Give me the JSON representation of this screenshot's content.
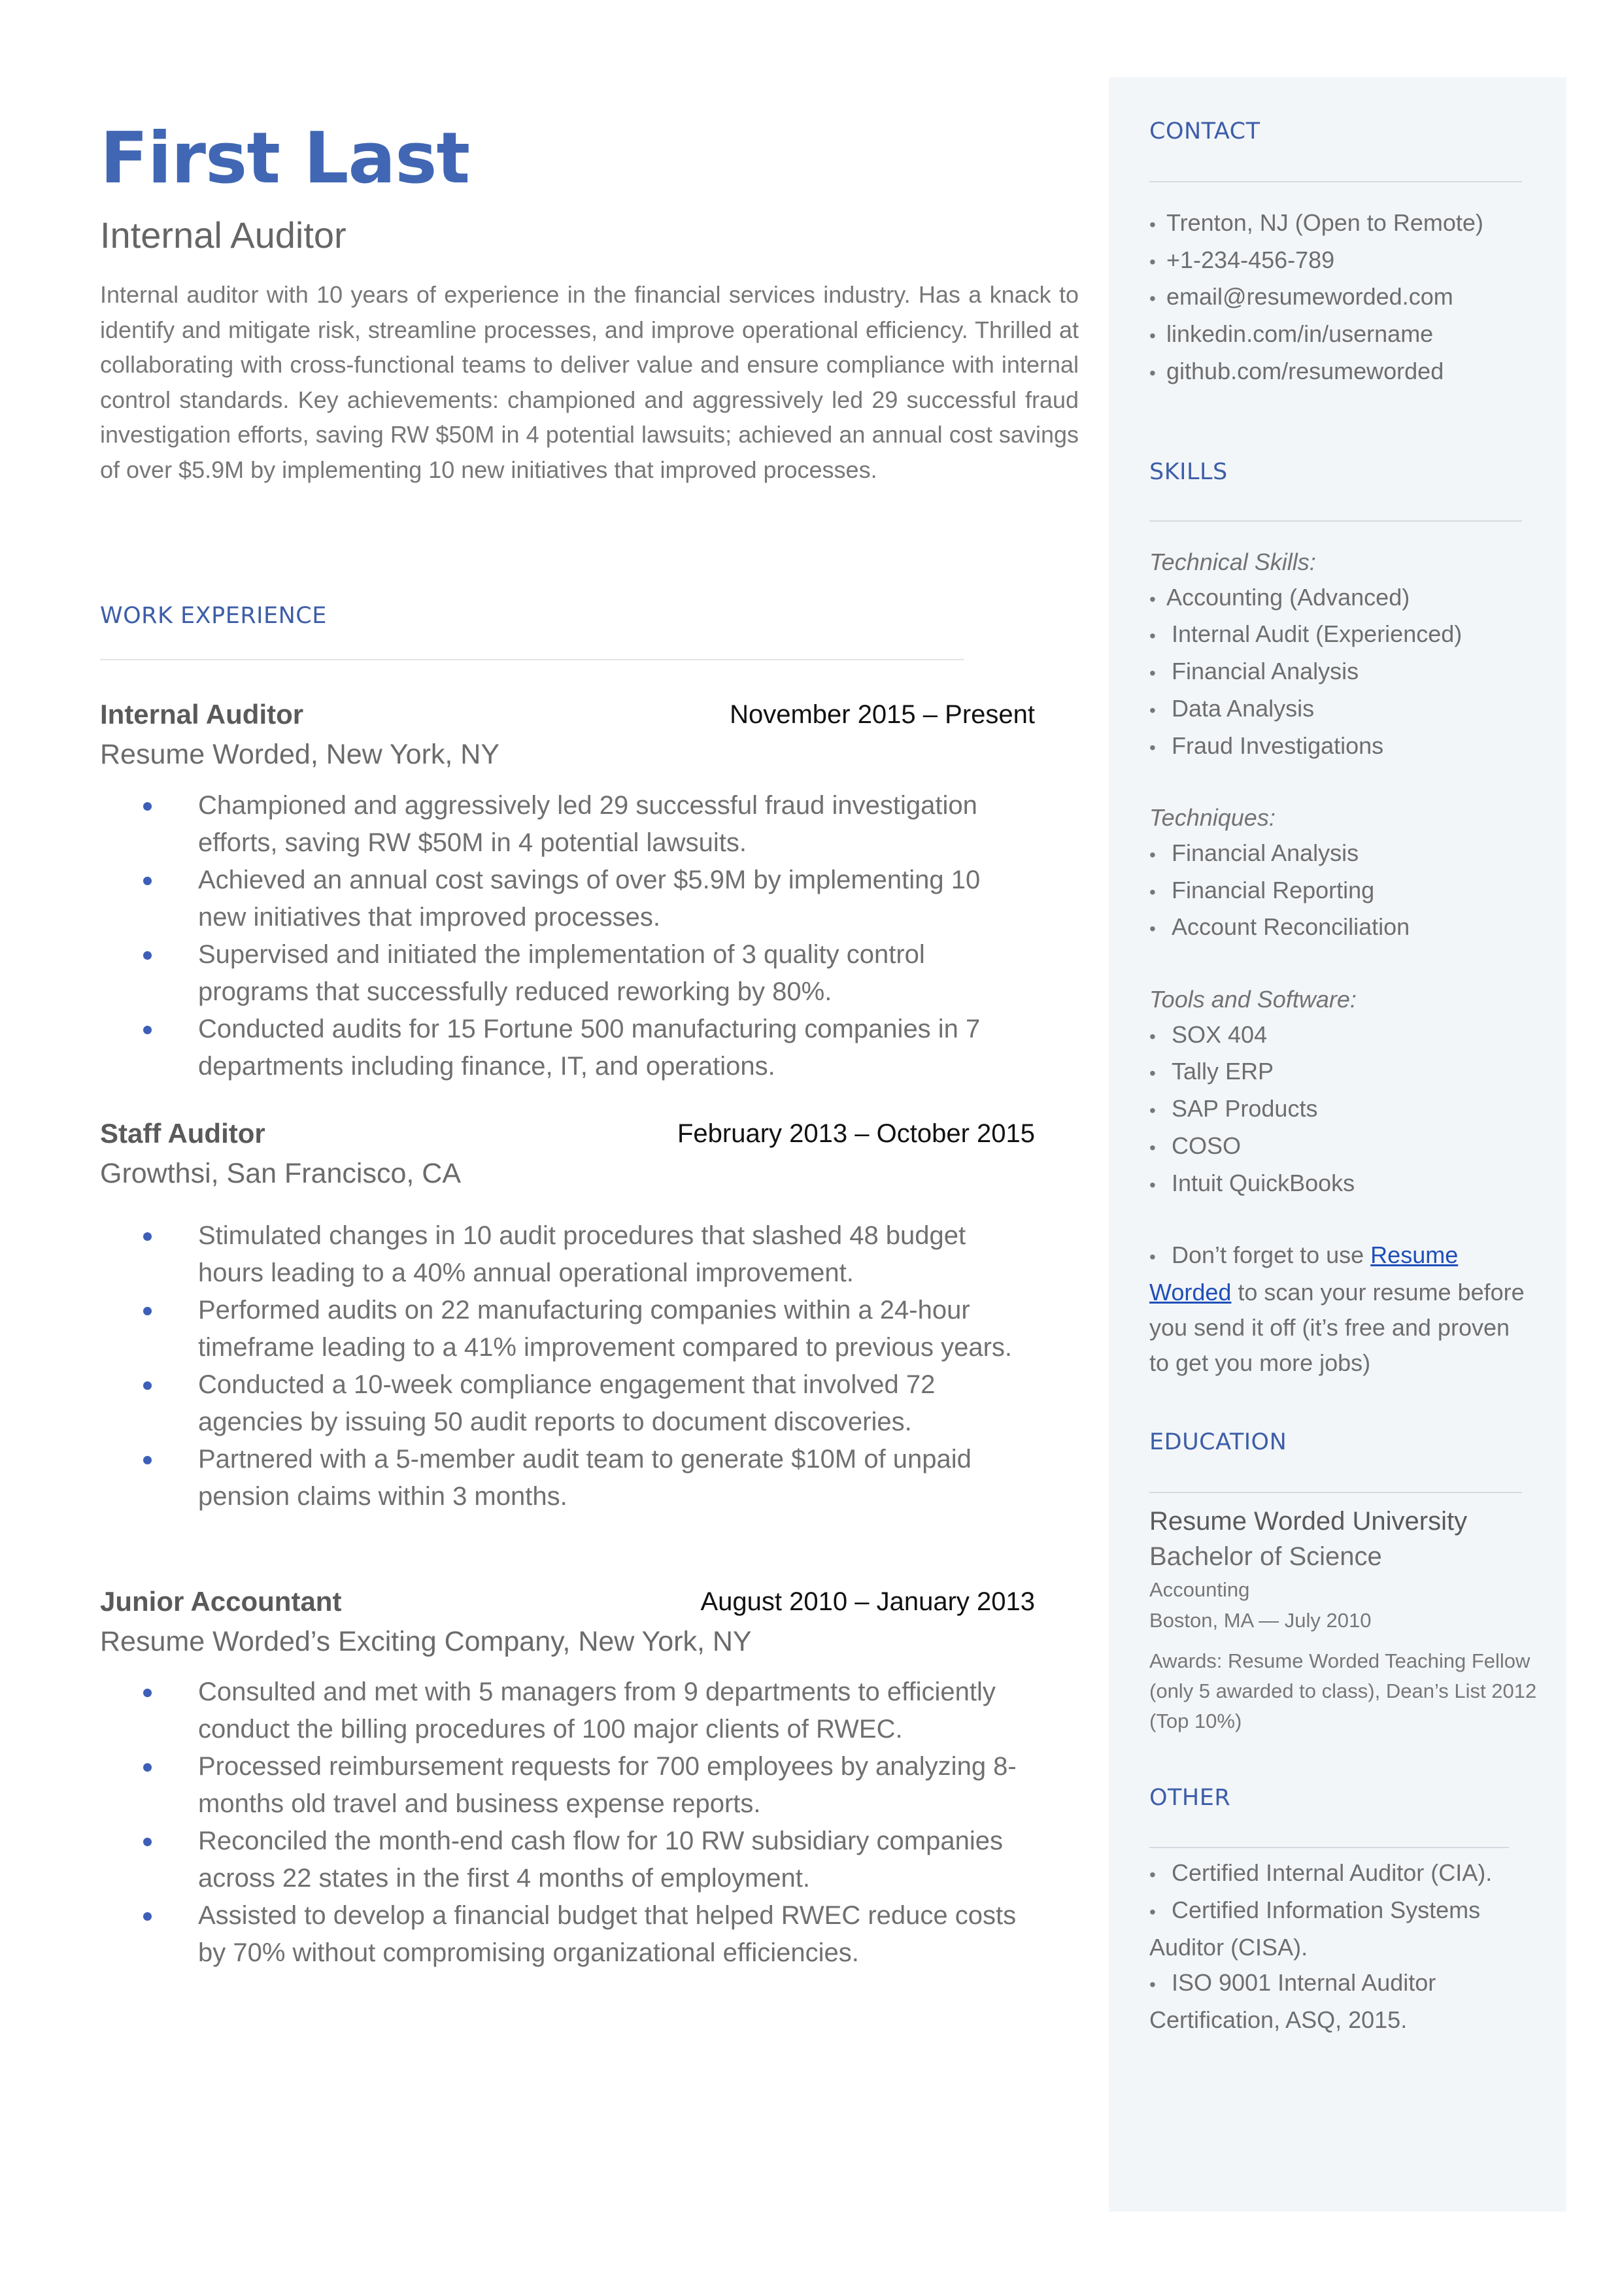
{
  "header": {
    "name": "First Last",
    "role": "Internal Auditor",
    "summary": "Internal auditor with 10 years of experience in the financial services industry. Has a knack to identify and mitigate risk, streamline processes, and improve operational efficiency. Thrilled at collaborating with cross-functional teams to deliver value and ensure compliance with internal control standards. Key achievements: championed and aggressively led 29 successful fraud investigation efforts, saving RW $50M in 4 potential lawsuits; achieved an annual cost savings of over $5.9M by implementing 10 new initiatives that improved processes."
  },
  "colors": {
    "accent": "#4167b4",
    "heading": "#3d5ea8",
    "sidebar_bg": "#f3f6f9",
    "link": "#1f4fb8"
  },
  "work": {
    "heading": "WORK EXPERIENCE",
    "jobs": [
      {
        "title": "Internal Auditor",
        "dates": "November 2015 – Present",
        "company": "Resume Worded, New York, NY",
        "bullets": [
          "Championed and aggressively led 29 successful fraud investigation efforts, saving RW $50M in 4 potential lawsuits.",
          "Achieved an annual cost savings of over $5.9M by implementing 10 new initiatives that improved processes.",
          "Supervised and initiated the implementation of 3 quality control programs that successfully reduced reworking by 80%.",
          "Conducted audits for 15 Fortune 500 manufacturing companies in 7 departments including finance, IT, and operations."
        ]
      },
      {
        "title": "Staff Auditor",
        "dates": "February 2013 – October 2015",
        "company": "Growthsi, San Francisco, CA",
        "bullets": [
          "Stimulated changes in 10 audit procedures that slashed 48 budget hours leading to a 40% annual operational improvement.",
          "Performed audits on 22 manufacturing companies within a 24-hour timeframe leading to a 41% improvement compared to previous years.",
          "Conducted a 10-week compliance engagement that involved 72 agencies by issuing 50 audit reports to document discoveries.",
          "Partnered with a 5-member audit team to generate $10M of unpaid pension claims within 3 months."
        ]
      },
      {
        "title": "Junior Accountant",
        "dates": "August 2010 – January 2013",
        "company": "Resume Worded’s Exciting Company, New York, NY",
        "bullets": [
          "Consulted and met with 5 managers from 9 departments to efficiently conduct the billing procedures of 100 major clients of  RWEC.",
          "Processed reimbursement requests for 700 employees by analyzing 8-months old travel and business expense reports.",
          "Reconciled the month-end cash flow for 10 RW subsidiary companies across 22 states in the first 4 months of employment.",
          "Assisted to develop a financial budget that helped RWEC reduce costs by 70% without compromising organizational efficiencies."
        ]
      }
    ]
  },
  "sidebar": {
    "contact": {
      "heading": "CONTACT",
      "items": [
        "Trenton, NJ (Open to Remote)",
        "+1-234-456-789",
        "email@resumeworded.com",
        "linkedin.com/in/username",
        "github.com/resumeworded"
      ]
    },
    "skills": {
      "heading": "SKILLS",
      "groups": [
        {
          "label": "Technical Skills:",
          "items": [
            "Accounting (Advanced)",
            "Internal Audit (Experienced)",
            "Financial Analysis",
            "Data Analysis",
            "Fraud Investigations"
          ]
        },
        {
          "label": "Techniques:",
          "items": [
            "Financial Analysis",
            "Financial Reporting",
            "Account Reconciliation"
          ]
        },
        {
          "label": "Tools and Software:",
          "items": [
            "SOX 404",
            "Tally ERP",
            "SAP Products",
            "COSO",
            "Intuit QuickBooks"
          ]
        }
      ],
      "tip": {
        "prefix": "Don’t forget to use ",
        "link_text": "Resume Worded",
        "suffix": " to scan your resume before you send it off (it’s free and proven to get you more jobs)"
      }
    },
    "education": {
      "heading": "EDUCATION",
      "school": "Resume Worded University",
      "degree": "Bachelor of Science",
      "field": "Accounting",
      "location_date": "Boston, MA — July 2010",
      "awards": "Awards: Resume Worded Teaching Fellow (only 5 awarded to class), Dean’s List 2012 (Top 10%)"
    },
    "other": {
      "heading": "OTHER",
      "items": [
        "Certified Internal Auditor (CIA).",
        "Certified Information Systems Auditor (CISA).",
        "ISO 9001 Internal Auditor Certification, ASQ, 2015."
      ]
    },
    "bullet_glyph": "•"
  }
}
